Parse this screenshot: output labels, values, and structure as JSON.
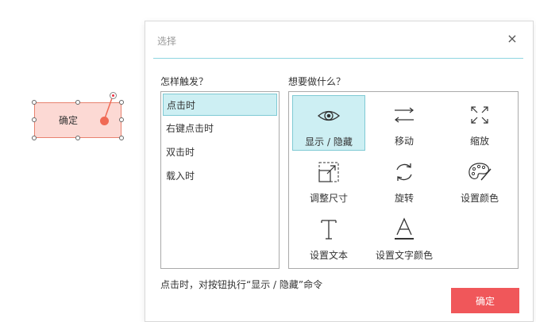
{
  "canvas": {
    "widget_label": "确定"
  },
  "dialog": {
    "title": "选择",
    "close_glyph": "×",
    "trigger_heading": "怎样触发？",
    "action_heading": "想要做什么？",
    "triggers": [
      {
        "label": "点击时",
        "selected": true
      },
      {
        "label": "右键点击时",
        "selected": false
      },
      {
        "label": "双击时",
        "selected": false
      },
      {
        "label": "载入时",
        "selected": false
      }
    ],
    "actions": [
      {
        "label": "显示 / 隐藏",
        "icon": "eye-icon",
        "selected": true
      },
      {
        "label": "移动",
        "icon": "move-arrows-icon",
        "selected": false
      },
      {
        "label": "缩放",
        "icon": "expand-icon",
        "selected": false
      },
      {
        "label": "调整尺寸",
        "icon": "resize-icon",
        "selected": false
      },
      {
        "label": "旋转",
        "icon": "rotate-icon",
        "selected": false
      },
      {
        "label": "设置颜色",
        "icon": "palette-icon",
        "selected": false
      },
      {
        "label": "设置文本",
        "icon": "text-icon",
        "selected": false
      },
      {
        "label": "设置文字颜色",
        "icon": "text-color-icon",
        "selected": false
      }
    ],
    "summary": "点击时，对按钮执行“显示 / 隐藏”命令",
    "ok_label": "确定"
  },
  "colors": {
    "accent": "#f0575a",
    "selection_bg": "#cdeff3",
    "selection_border": "#7fcad4",
    "widget_fill": "#fcd9d4",
    "widget_border": "#e8826f"
  }
}
